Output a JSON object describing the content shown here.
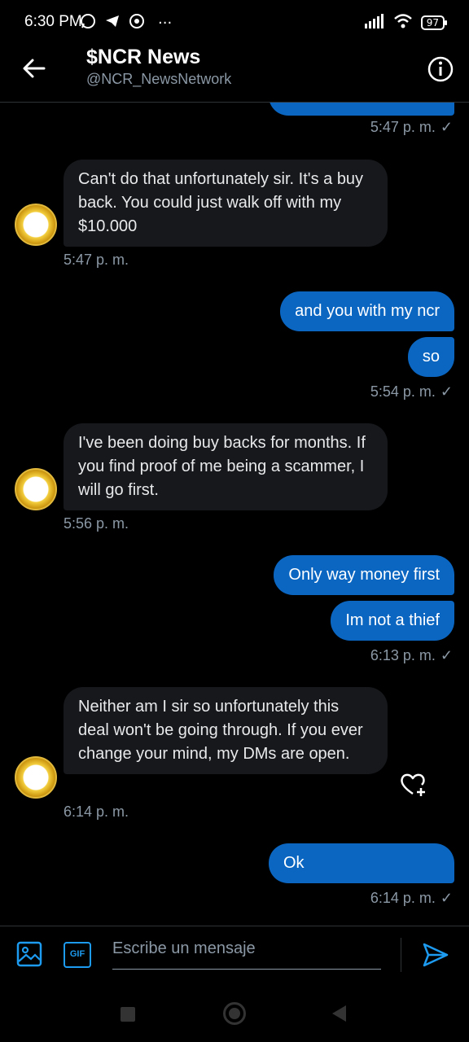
{
  "status_bar": {
    "time": "6:30 PM",
    "battery": "97"
  },
  "header": {
    "title": "$NCR News",
    "handle": "@NCR_NewsNetwork"
  },
  "messages": [
    {
      "dir": "in",
      "text": "Can't do that unfortunately sir. It's a buy back. You could just walk off with my $10.000",
      "time": "5:47 p. m."
    },
    {
      "dir": "out",
      "text": "and you with my ncr"
    },
    {
      "dir": "out",
      "text": "so",
      "time": "5:54 p. m."
    },
    {
      "dir": "in",
      "text": "I've been doing buy backs for months. If you find proof of me being a scammer, I will go first.",
      "time": "5:56 p. m."
    },
    {
      "dir": "out",
      "text": "Only way money first"
    },
    {
      "dir": "out",
      "text": "Im not a thief",
      "time": "6:13 p. m."
    },
    {
      "dir": "in",
      "text": "Neither am I sir so unfortunately this deal won't be going through. If you ever change your mind, my DMs are open.",
      "time": "6:14 p. m."
    },
    {
      "dir": "out",
      "text": "Ok",
      "time": "6:14 p. m."
    }
  ],
  "top_partial_time": "5:47 p. m.",
  "composer": {
    "placeholder": "Escribe un mensaje",
    "gif_label": "GIF"
  },
  "colors": {
    "accent": "#1d9bf0",
    "out_bubble": "#0b66c2",
    "in_bubble": "#16181c",
    "muted": "#8b98a5"
  }
}
